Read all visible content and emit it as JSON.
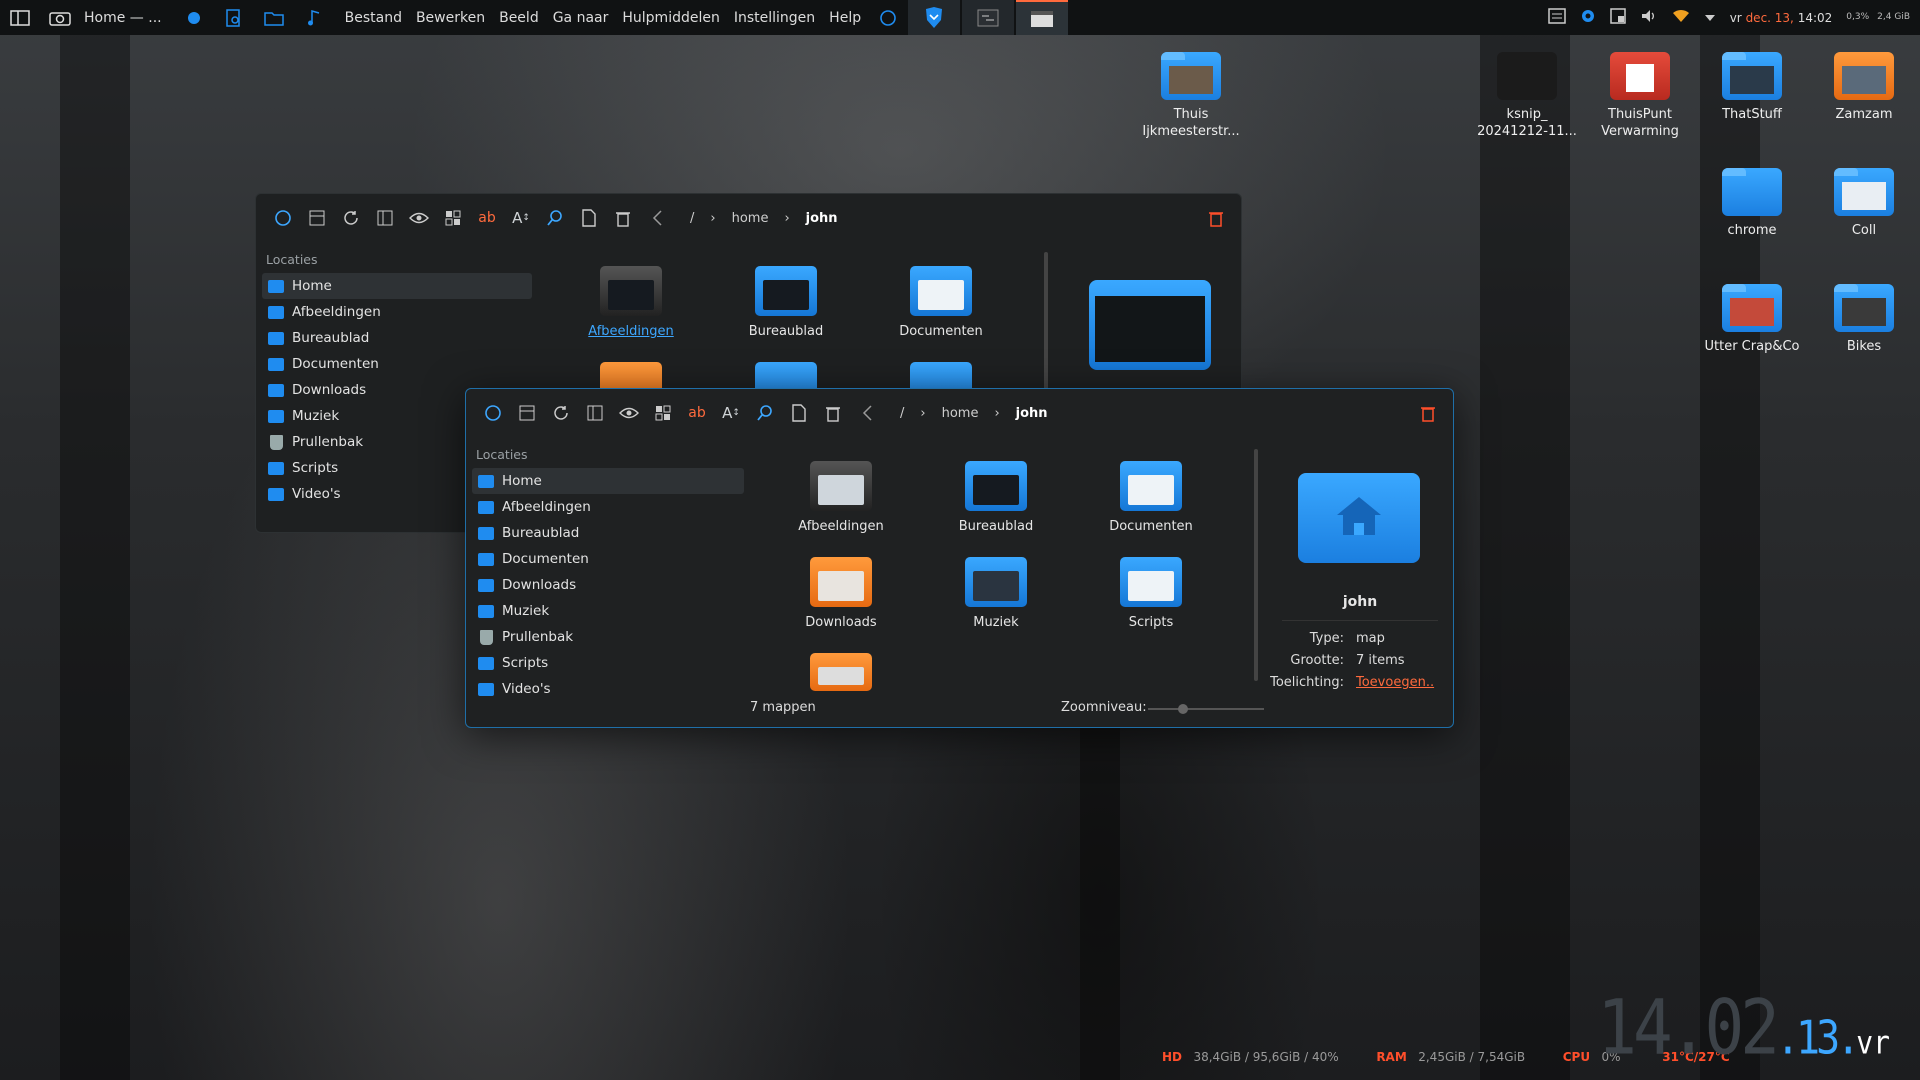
{
  "panel": {
    "window_title": "Home — ...",
    "menu": [
      "Bestand",
      "Bewerken",
      "Beeld",
      "Ga naar",
      "Hulpmiddelen",
      "Instellingen",
      "Help"
    ],
    "tray": {
      "cpu_small": "0,3%",
      "mem_small": "2,4 GiB",
      "clock_prefix": "vr",
      "clock_date": "dec. 13,",
      "clock_time": "14:02"
    }
  },
  "desktop_icons": [
    {
      "label": "Thuis Ijkmeesterstr...",
      "icon": "photo-folder-icon"
    },
    {
      "label": "ksnip_ 20241212-11...",
      "icon": "screenshot-file-icon"
    },
    {
      "label": "ThuisPunt Verwarming",
      "icon": "red-folder-icon"
    },
    {
      "label": "ThatStuff",
      "icon": "photo-folder-icon"
    },
    {
      "label": "Zamzam",
      "icon": "photo-folder-icon"
    },
    {
      "label": "chrome",
      "icon": "folder-icon"
    },
    {
      "label": "Coll",
      "icon": "photo-folder-icon"
    },
    {
      "label": "Utter Crap&Co",
      "icon": "photo-folder-icon"
    },
    {
      "label": "Bikes",
      "icon": "photo-folder-icon"
    }
  ],
  "back_window": {
    "breadcrumb": [
      "/",
      "home",
      "john"
    ],
    "sidebar_heading": "Locaties",
    "sidebar": [
      "Home",
      "Afbeeldingen",
      "Bureaublad",
      "Documenten",
      "Downloads",
      "Muziek",
      "Prullenbak",
      "Scripts",
      "Video's"
    ],
    "files": [
      "Afbeeldingen",
      "Bureaublad",
      "Documenten"
    ]
  },
  "front_window": {
    "breadcrumb": [
      "/",
      "home",
      "john"
    ],
    "sidebar_heading": "Locaties",
    "sidebar": [
      "Home",
      "Afbeeldingen",
      "Bureaublad",
      "Documenten",
      "Downloads",
      "Muziek",
      "Prullenbak",
      "Scripts",
      "Video's"
    ],
    "files": [
      "Afbeeldingen",
      "Bureaublad",
      "Documenten",
      "Downloads",
      "Muziek",
      "Scripts"
    ],
    "status": "7 mappen",
    "zoom_label": "Zoomniveau:",
    "zoom_level": 0.3,
    "info": {
      "name": "john",
      "type_key": "Type:",
      "type_val": "map",
      "size_key": "Grootte:",
      "size_val": "7 items",
      "comment_key": "Toelichting:",
      "comment_val": "Toevoegen.."
    }
  },
  "stats": {
    "hd_label": "HD",
    "hd_val": "38,4GiB / 95,6GiB / 40%",
    "ram_label": "RAM",
    "ram_val": "2,45GiB / 7,54GiB",
    "cpu_label": "CPU",
    "cpu_val": "0%",
    "temp": "31°C/27°C"
  },
  "bigclock": {
    "hm": "14.02",
    "day": "13",
    "wd": "vr"
  },
  "colors": {
    "accent": "#3da7ff",
    "warning": "#ff4f2b",
    "folder": "#1f8cf0"
  }
}
